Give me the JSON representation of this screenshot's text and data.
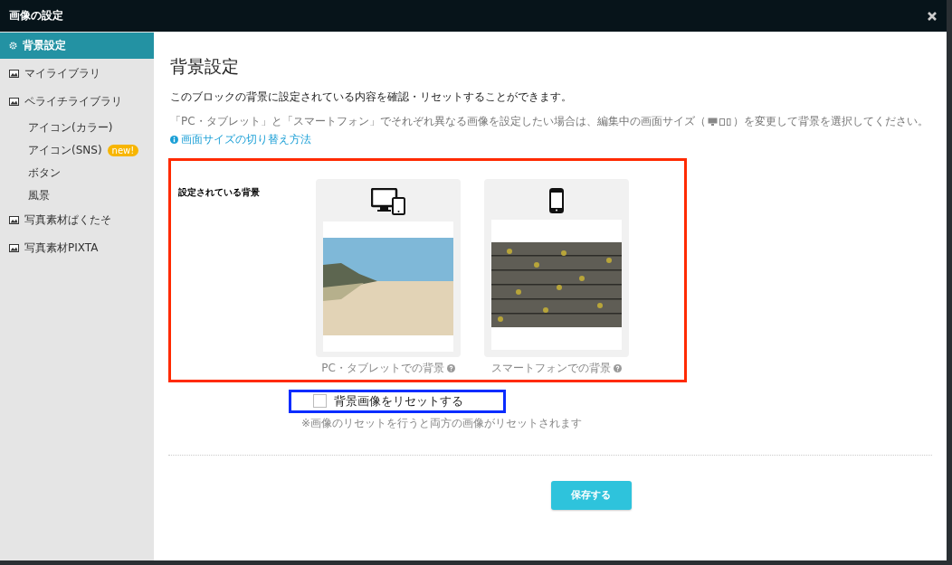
{
  "window": {
    "title": "画像の設定"
  },
  "sidebar": {
    "items": [
      {
        "kind": "section",
        "label": "背景設定",
        "selected": true
      },
      {
        "kind": "section",
        "label": "マイライブラリ",
        "selected": false
      },
      {
        "kind": "section",
        "label": "ペライチライブラリ",
        "selected": false
      },
      {
        "kind": "sub",
        "label": "アイコン(カラー)",
        "selected": false
      },
      {
        "kind": "sub",
        "label": "アイコン(SNS)",
        "badge": "new!",
        "selected": false
      },
      {
        "kind": "sub",
        "label": "ボタン",
        "selected": false
      },
      {
        "kind": "sub",
        "label": "風景",
        "selected": false
      },
      {
        "kind": "section",
        "label": "写真素材ぱくたそ",
        "selected": false
      },
      {
        "kind": "section",
        "label": "写真素材PIXTA",
        "selected": false
      }
    ]
  },
  "main": {
    "heading": "背景設定",
    "description": "このブロックの背景に設定されている内容を確認・リセットすることができます。",
    "note_before": "「PC・タブレット」と「スマートフォン」でそれぞれ異なる画像を設定したい場合は、編集中の画面サイズ（",
    "note_after": "）を変更して背景を選択してください。",
    "help_link": "画面サイズの切り替え方法",
    "section_label": "設定されている背景",
    "previews": [
      {
        "kind": "desktop",
        "caption": "PC・タブレットでの背景"
      },
      {
        "kind": "phone",
        "caption": "スマートフォンでの背景"
      }
    ],
    "reset": {
      "label": "背景画像をリセットする",
      "checked": false,
      "note": "※画像のリセットを行うと両方の画像がリセットされます"
    },
    "save_button": "保存する"
  }
}
